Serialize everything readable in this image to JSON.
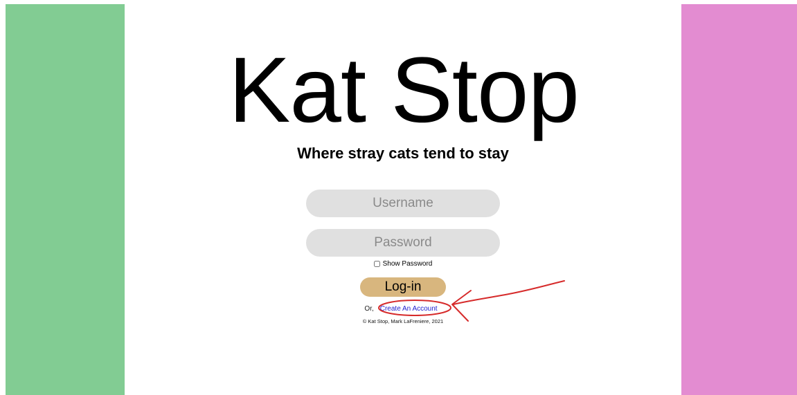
{
  "site": {
    "title": "Kat Stop",
    "tagline": "Where stray cats tend to stay"
  },
  "login_form": {
    "username_placeholder": "Username",
    "password_placeholder": "Password",
    "show_password_label": "Show Password",
    "show_password_checked": false,
    "login_button_label": "Log-in",
    "or_text": "Or,",
    "create_account_link": "Create An Account"
  },
  "footer": {
    "copyright": "© Kat Stop, Mark LaFreniere, 2021"
  },
  "colors": {
    "left_panel": "#82cc93",
    "right_panel": "#e38cd1",
    "input_background": "#e0e0e0",
    "login_button": "#d8b67e",
    "link": "#2020d0",
    "annotation": "#d62a2a"
  }
}
